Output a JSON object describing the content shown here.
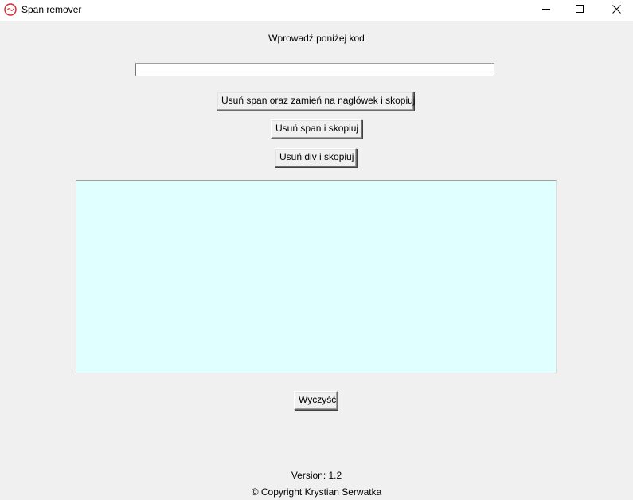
{
  "window": {
    "title": "Span remover",
    "icon": "app-logo-icon",
    "controls": {
      "minimize_icon": "minimize-icon",
      "maximize_icon": "maximize-icon",
      "close_icon": "close-icon"
    }
  },
  "main": {
    "prompt_label": "Wprowadź poniżej kod",
    "code_input": {
      "value": "",
      "placeholder": ""
    },
    "buttons": {
      "remove_span_header_copy": "Usuń span oraz zamień na nagłówek i skopiuj",
      "remove_span_copy": "Usuń span i skopiuj",
      "remove_div_copy": "Usuń div i skopiuj",
      "clear": "Wyczyść"
    },
    "output_text": ""
  },
  "footer": {
    "version": "Version: 1.2",
    "copyright": "© Copyright Krystian Serwatka"
  },
  "colors": {
    "window_bg": "#f0f0f0",
    "titlebar_bg": "#ffffff",
    "output_bg": "#e0ffff",
    "logo_red": "#d9262c"
  }
}
